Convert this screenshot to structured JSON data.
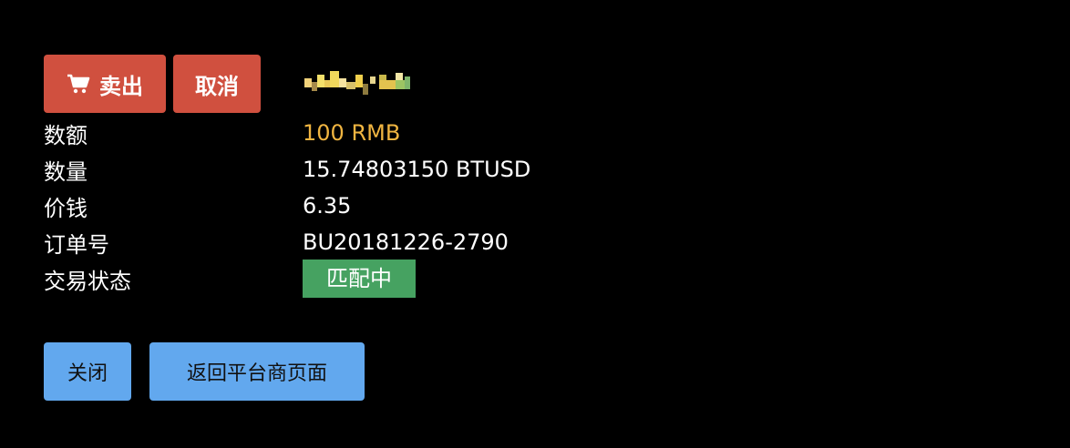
{
  "actions": {
    "sell_label": "卖出",
    "cancel_label": "取消"
  },
  "details": {
    "rows": [
      {
        "label": "数额",
        "value": "100 RMB"
      },
      {
        "label": "数量",
        "value": "15.74803150 BTUSD"
      },
      {
        "label": "价钱",
        "value": "6.35"
      },
      {
        "label": "订单号",
        "value": "BU20181226-2790"
      },
      {
        "label": "交易状态",
        "value": "匹配中"
      }
    ]
  },
  "footer": {
    "close_label": "关闭",
    "back_label": "返回平台商页面"
  },
  "colors": {
    "background": "#000000",
    "danger_button": "#d0503f",
    "primary_button": "#62a8ee",
    "amount_text": "#f0b541",
    "status_badge": "#46a261"
  },
  "icons": {
    "sell": "shopping-cart-icon",
    "merchant": "merchant-logo"
  }
}
